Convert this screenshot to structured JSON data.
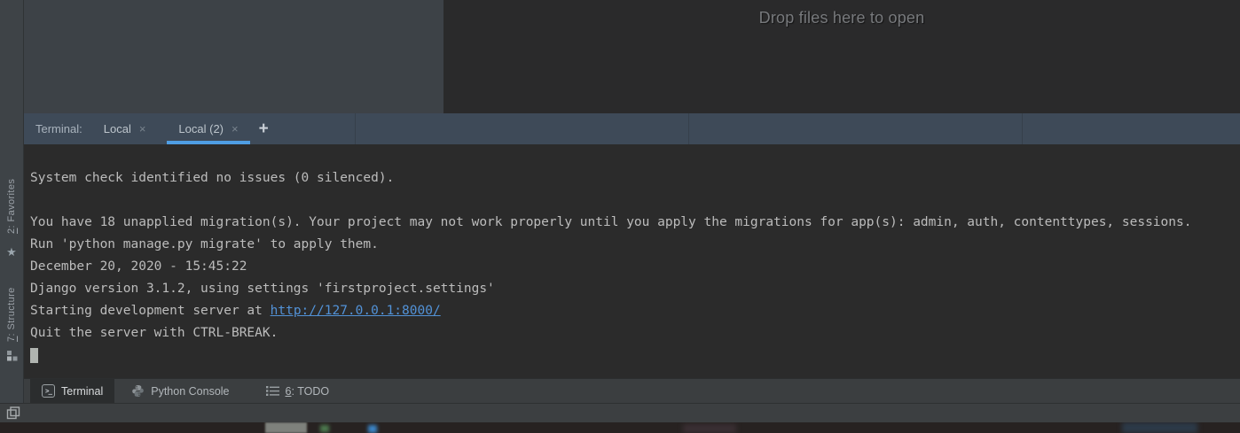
{
  "colors": {
    "accent_blue": "#4f9ee3",
    "link_blue": "#5292d7",
    "terminal_bg": "#2b2b2b",
    "terminal_tabbar_bg": "#3e4a58",
    "panel_bg": "#3d4247",
    "toolbar_bg": "#3b3e40",
    "cursor_gray": "#b0b4b0"
  },
  "editor": {
    "drop_hint": "Drop files here to open"
  },
  "terminal_tabbar": {
    "label": "Terminal:",
    "tabs": [
      {
        "label": "Local",
        "selected": false
      },
      {
        "label": "Local (2)",
        "selected": true
      }
    ],
    "add_button": "+"
  },
  "terminal": {
    "lines": [
      "System check identified no issues (0 silenced).",
      "",
      "You have 18 unapplied migration(s). Your project may not work properly until you apply the migrations for app(s): admin, auth, contenttypes, sessions.",
      "Run 'python manage.py migrate' to apply them.",
      "December 20, 2020 - 15:45:22",
      "Django version 3.1.2, using settings 'firstproject.settings'"
    ],
    "server_line": {
      "prefix": "Starting development server at ",
      "link": "http://127.0.0.1:8000/"
    },
    "quit_line": "Quit the server with CTRL-BREAK."
  },
  "tool_window_bar": {
    "terminal_tab": {
      "label": "Terminal"
    },
    "python_console_tab": {
      "label": "Python Console"
    },
    "todo_tab": {
      "mnemonic": "6",
      "label": ": TODO"
    }
  },
  "left_stripe": {
    "favorites": {
      "mnemonic": "2",
      "label": ": Favorites"
    },
    "structure": {
      "mnemonic": "7",
      "label": ": Structure"
    }
  },
  "icons": {
    "star": "★",
    "terminal_glyph": ">_",
    "close": "×"
  }
}
